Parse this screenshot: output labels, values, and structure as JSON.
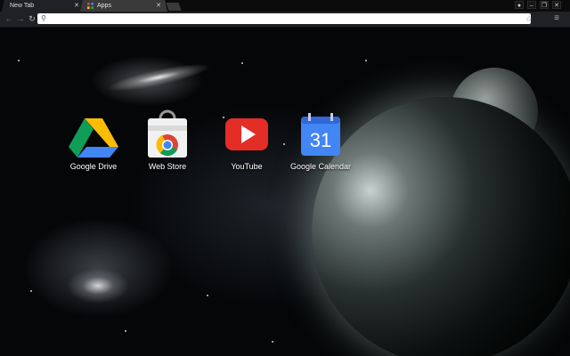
{
  "tabs": [
    {
      "label": "New Tab",
      "active": true
    },
    {
      "label": "Apps",
      "active": false
    }
  ],
  "window_controls": [
    "user-icon",
    "minimize-icon",
    "restore-icon",
    "close-icon"
  ],
  "toolbar": {
    "back": "←",
    "forward": "→",
    "reload": "↻",
    "omnibox_value": "",
    "omnibox_placeholder": "",
    "menu": "≡"
  },
  "apps": [
    {
      "label": "Google Drive",
      "icon": "google-drive-icon"
    },
    {
      "label": "Web Store",
      "icon": "web-store-icon"
    },
    {
      "label": "YouTube",
      "icon": "youtube-icon"
    },
    {
      "label": "Google Calendar",
      "icon": "google-calendar-icon",
      "icon_text": "31"
    }
  ],
  "colors": {
    "tab_active": "#202124",
    "tab_inactive": "#3a3a3a",
    "youtube_red": "#e52d27",
    "calendar_blue": "#4285f4"
  }
}
